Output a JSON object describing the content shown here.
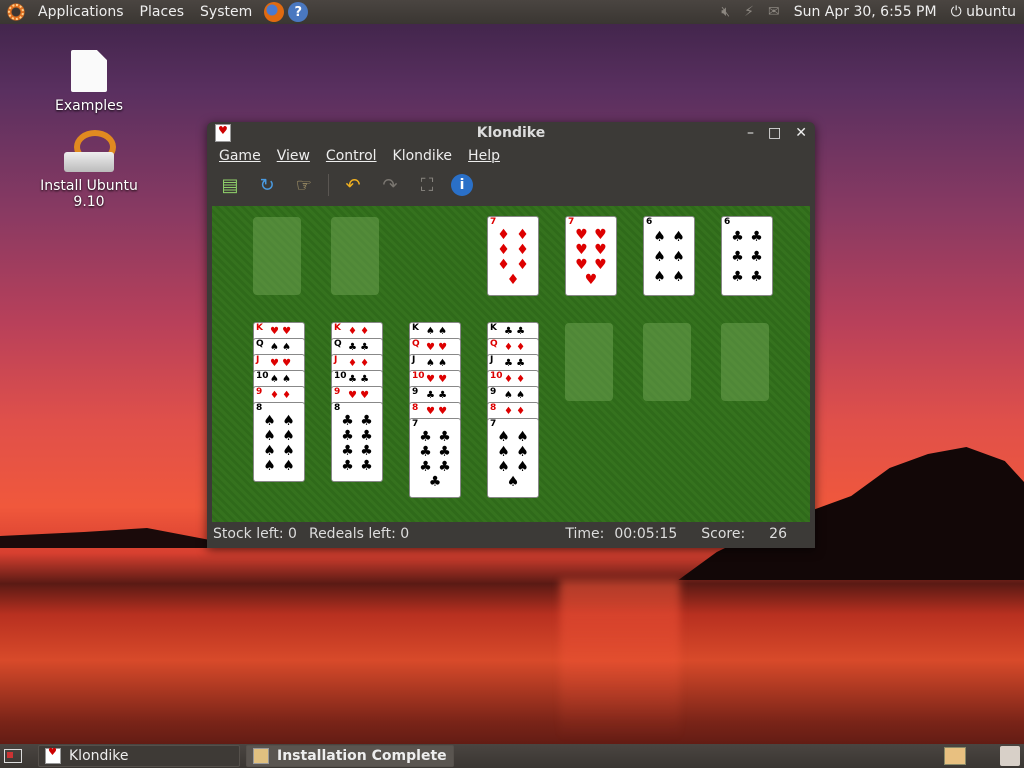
{
  "top_panel": {
    "menus": [
      "Applications",
      "Places",
      "System"
    ],
    "clock": "Sun Apr 30,  6:55 PM",
    "user": "ubuntu"
  },
  "desktop": {
    "icons": [
      {
        "label": "Examples"
      },
      {
        "label": "Install Ubuntu 9.10"
      }
    ]
  },
  "window": {
    "title": "Klondike",
    "controls": {
      "minimize": "–",
      "maximize": "□",
      "close": "✕"
    },
    "menus": [
      "Game",
      "View",
      "Control",
      "Klondike",
      "Help"
    ],
    "toolbar": {
      "buttons": [
        "new-game",
        "restart",
        "hint",
        "undo",
        "redo",
        "fullscreen",
        "info"
      ]
    },
    "status": {
      "stock_label": "Stock left:",
      "stock_value": "0",
      "redeals_label": "Redeals left:",
      "redeals_value": "0",
      "time_label": "Time:",
      "time_value": "00:05:15",
      "score_label": "Score:",
      "score_value": "26"
    }
  },
  "board": {
    "foundations": [
      {
        "rank": "7",
        "suit": "♦",
        "color": "red"
      },
      {
        "rank": "7",
        "suit": "♥",
        "color": "red"
      },
      {
        "rank": "6",
        "suit": "♠",
        "color": "black"
      },
      {
        "rank": "6",
        "suit": "♣",
        "color": "black"
      }
    ],
    "tableau": [
      {
        "slivers": [
          {
            "r": "K",
            "s": "♥"
          },
          {
            "r": "Q",
            "s": "♠"
          },
          {
            "r": "J",
            "s": "♥"
          },
          {
            "r": "10",
            "s": "♠"
          },
          {
            "r": "9",
            "s": "♦"
          }
        ],
        "top": {
          "r": "8",
          "s": "♠",
          "c": "black"
        }
      },
      {
        "slivers": [
          {
            "r": "K",
            "s": "♦"
          },
          {
            "r": "Q",
            "s": "♣"
          },
          {
            "r": "J",
            "s": "♦"
          },
          {
            "r": "10",
            "s": "♣"
          },
          {
            "r": "9",
            "s": "♥"
          }
        ],
        "top": {
          "r": "8",
          "s": "♣",
          "c": "black"
        }
      },
      {
        "slivers": [
          {
            "r": "K",
            "s": "♠"
          },
          {
            "r": "Q",
            "s": "♥"
          },
          {
            "r": "J",
            "s": "♠"
          },
          {
            "r": "10",
            "s": "♥"
          },
          {
            "r": "9",
            "s": "♣"
          },
          {
            "r": "8",
            "s": "♥"
          }
        ],
        "top": {
          "r": "7",
          "s": "♣",
          "c": "black"
        }
      },
      {
        "slivers": [
          {
            "r": "K",
            "s": "♣"
          },
          {
            "r": "Q",
            "s": "♦"
          },
          {
            "r": "J",
            "s": "♣"
          },
          {
            "r": "10",
            "s": "♦"
          },
          {
            "r": "9",
            "s": "♠"
          },
          {
            "r": "8",
            "s": "♦"
          }
        ],
        "top": {
          "r": "7",
          "s": "♠",
          "c": "black"
        }
      }
    ]
  },
  "bottom_panel": {
    "tasks": [
      {
        "label": "Klondike"
      },
      {
        "label": "Installation Complete"
      }
    ]
  }
}
